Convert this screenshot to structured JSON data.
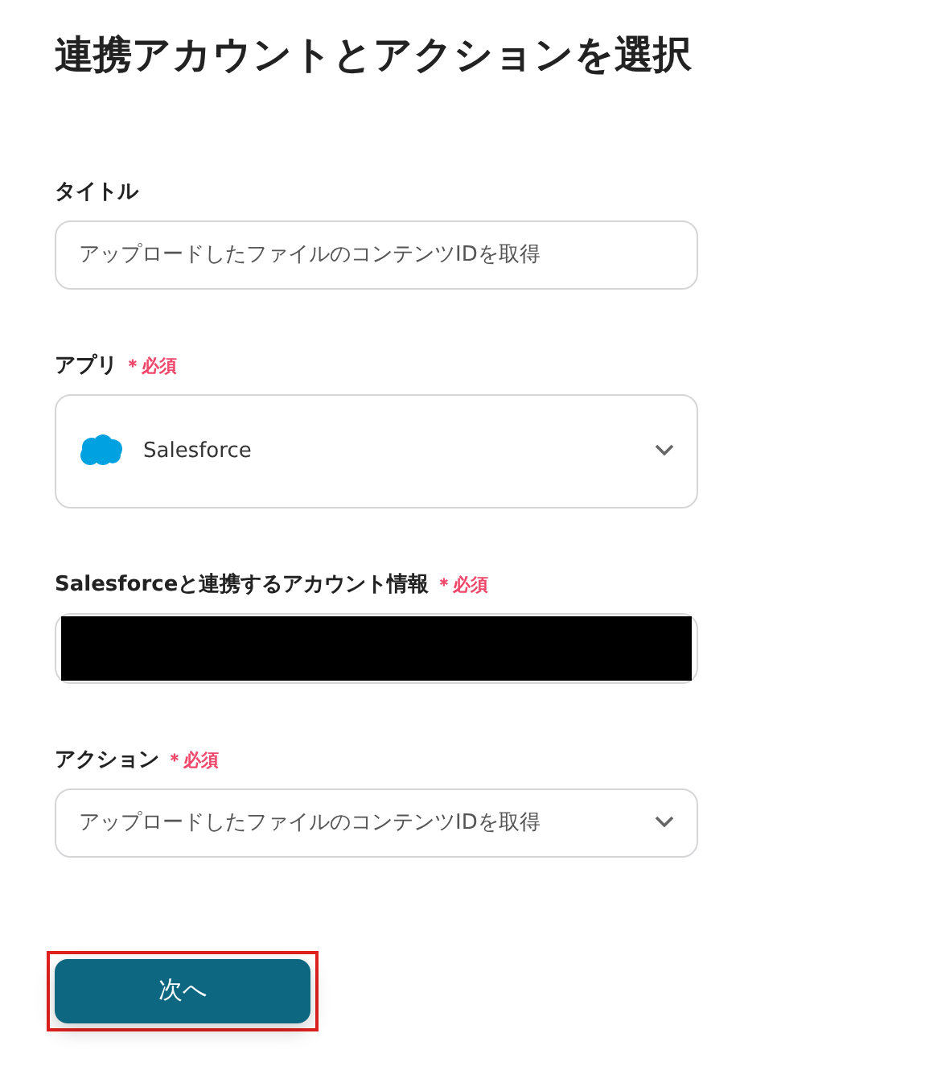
{
  "heading": "連携アカウントとアクションを選択",
  "fields": [
    {
      "kind": "text",
      "label": "タイトル",
      "value": "アップロードしたファイルのコンテンツIDを取得"
    },
    {
      "kind": "app",
      "label": "アプリ",
      "required_label": "＊必須",
      "value": "Salesforce"
    },
    {
      "kind": "redacted",
      "label": "Salesforceと連携するアカウント情報",
      "required_label": "＊必須"
    },
    {
      "kind": "select",
      "label": "アクション",
      "required_label": "＊必須",
      "value": "アップロードしたファイルのコンテンツIDを取得"
    }
  ],
  "next_button": {
    "label": "次へ",
    "highlighted": true
  }
}
